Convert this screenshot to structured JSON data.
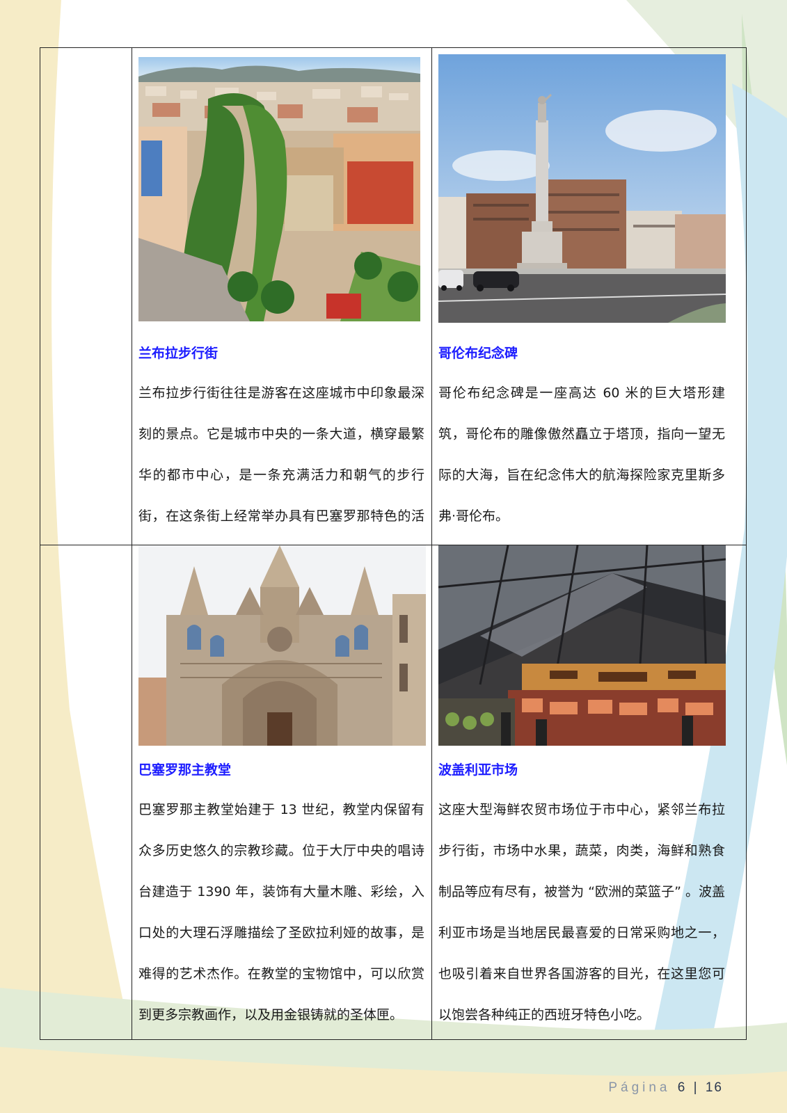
{
  "attractions": [
    {
      "title": "兰布拉步行街",
      "description": "兰布拉步行街往往是游客在这座城市中印象最深刻的景点。它是城市中央的一条大道，横穿最繁华的都市中心，是一条充满活力和朝气的步行街，在这条街上经常举办具有巴塞罗那特色的活动。",
      "photo": "aerial-view-of-la-rambla-boulevard"
    },
    {
      "title": "哥伦布纪念碑",
      "description": "哥伦布纪念碑是一座高达 60 米的巨大塔形建筑，哥伦布的雕像傲然矗立于塔顶，指向一望无际的大海，旨在纪念伟大的航海探险家克里斯多弗·哥伦布。",
      "photo": "columbus-monument-column"
    },
    {
      "title": "巴塞罗那主教堂",
      "description": "巴塞罗那主教堂始建于 13 世纪，教堂内保留有众多历史悠久的宗教珍藏。位于大厅中央的唱诗台建造于 1390 年，装饰有大量木雕、彩绘，入口处的大理石浮雕描绘了圣欧拉利娅的故事，是难得的艺术杰作。在教堂的宝物馆中，可以欣赏到更多宗教画作，以及用金银铸就的圣体匣。",
      "photo": "gothic-cathedral-facade"
    },
    {
      "title": "波盖利亚市场",
      "description": "这座大型海鲜农贸市场位于市中心，紧邻兰布拉步行街，市场中水果，蔬菜，肉类，海鲜和熟食制品等应有尽有，被誉为 “欧洲的菜篮子” 。波盖利亚市场是当地居民最喜爱的日常采购地之一，也吸引着来自世界各国游客的目光，在这里您可以饱尝各种纯正的西班牙特色小吃。",
      "photo": "covered-market-stalls"
    }
  ],
  "footer": {
    "page_label": "Página",
    "page_current": "6",
    "separator": "|",
    "page_total": "16"
  },
  "colors": {
    "title": "#1c1cff",
    "body_text": "#1a1a1a",
    "bg_cream": "#f6ecc7",
    "bg_green": "#dfe9d4",
    "bg_blue": "#cce7f2"
  }
}
